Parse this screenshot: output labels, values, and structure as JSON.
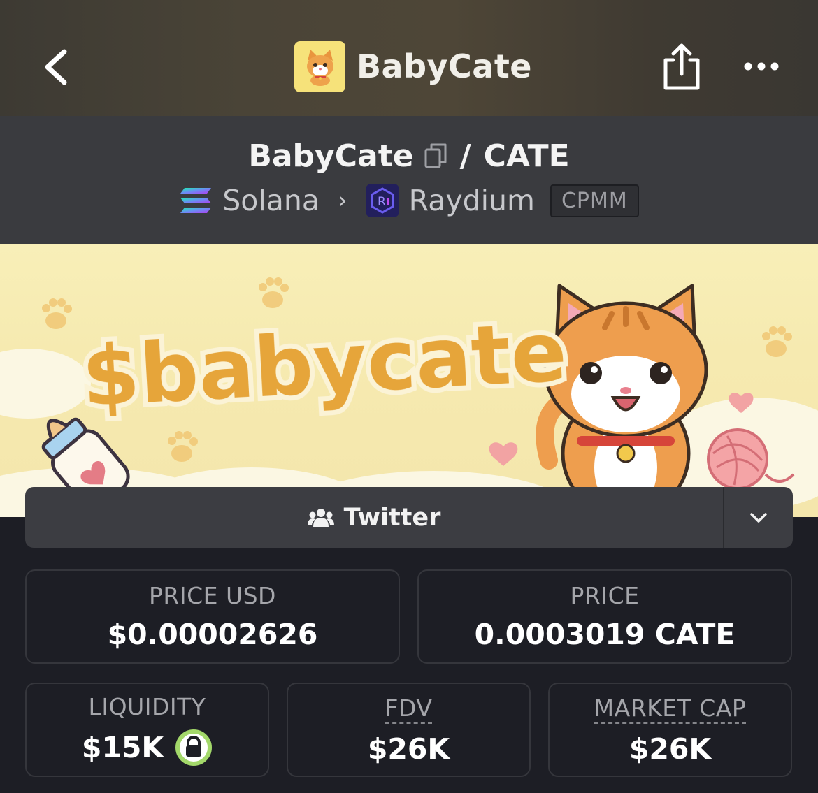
{
  "header": {
    "title": "BabyCate",
    "back_icon": "chevron-left-icon",
    "share_icon": "share-icon",
    "more_icon": "ellipsis-icon"
  },
  "pair": {
    "base": "BabyCate",
    "separator": "/",
    "quote": "CATE",
    "copy_icon": "copy-icon",
    "chain": "Solana",
    "dex": "Raydium",
    "pool_type": "CPMM"
  },
  "banner": {
    "text": "$babycate"
  },
  "socials": {
    "twitter_label": "Twitter",
    "twitter_icon": "users-icon",
    "toggle_icon": "chevron-down-icon"
  },
  "stats": {
    "price_usd_label": "PRICE USD",
    "price_usd_value": "$0.00002626",
    "price_label": "PRICE",
    "price_value": "0.0003019 CATE",
    "liquidity_label": "LIQUIDITY",
    "liquidity_value": "$15K",
    "fdv_label": "FDV",
    "fdv_value": "$26K",
    "mcap_label": "MARKET CAP",
    "mcap_value": "$26K"
  },
  "colors": {
    "background": "#1d1e25",
    "header_bar": "#3a3b3f",
    "banner_yellow": "#f6eab0",
    "lock_ring": "#a3d86a"
  }
}
